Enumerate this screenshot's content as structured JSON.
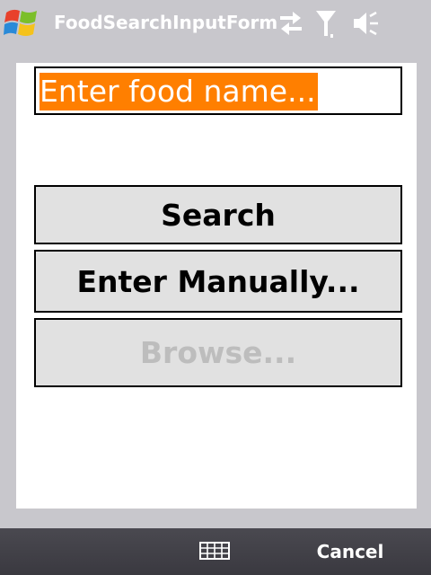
{
  "titlebar": {
    "title": "FoodSearchInputForm",
    "icons": [
      "windows-start-logo",
      "connectivity-icon",
      "signal-icon",
      "volume-icon"
    ]
  },
  "form": {
    "food_input_value": "Enter food name...",
    "search_label": "Search",
    "manual_label": "Enter Manually...",
    "browse_label": "Browse..."
  },
  "menubar": {
    "keyboard_icon": "keyboard-icon",
    "cancel_label": "Cancel"
  },
  "colors": {
    "selection": "#ff7f00",
    "button_bg": "#e1e1e1",
    "disabled_text": "#bdbdbd",
    "menubar_bg": "#3f3e45"
  }
}
